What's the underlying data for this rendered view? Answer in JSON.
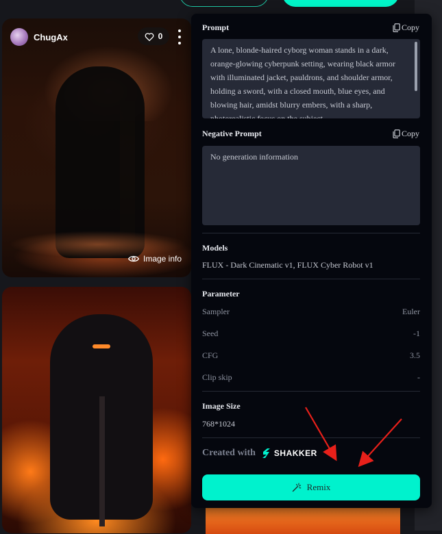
{
  "card": {
    "author": "ChugAx",
    "likes": "0",
    "image_info_label": "Image info"
  },
  "panel": {
    "prompt": {
      "title": "Prompt",
      "copy_label": "Copy",
      "text": "A lone, blonde-haired cyborg woman stands in a dark, orange-glowing cyberpunk setting, wearing black armor with illuminated jacket, pauldrons, and shoulder armor, holding a sword, with a closed mouth, blue eyes, and blowing hair, amidst blurry embers, with a sharp, photorealistic focus on the subject."
    },
    "negative_prompt": {
      "title": "Negative Prompt",
      "copy_label": "Copy",
      "text": "No generation information"
    },
    "models": {
      "title": "Models",
      "value": "FLUX - Dark Cinematic v1, FLUX Cyber Robot v1"
    },
    "parameter": {
      "title": "Parameter",
      "rows": [
        {
          "label": "Sampler",
          "value": "Euler"
        },
        {
          "label": "Seed",
          "value": "-1"
        },
        {
          "label": "CFG",
          "value": "3.5"
        },
        {
          "label": "Clip skip",
          "value": "-"
        }
      ]
    },
    "image_size": {
      "title": "Image Size",
      "value": "768*1024"
    },
    "created_with": "Created with",
    "brand": "SHAKKER",
    "remix_label": "Remix"
  },
  "colors": {
    "accent": "#00f2cd",
    "panel_bg": "#05070e",
    "textbox_bg": "#262a37",
    "annotation_arrow": "#e8201a"
  }
}
